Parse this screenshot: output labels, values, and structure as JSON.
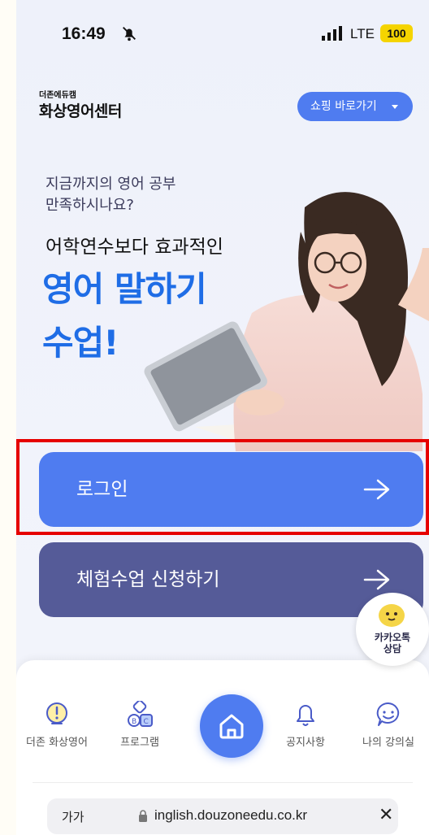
{
  "status": {
    "time": "16:49",
    "network": "LTE",
    "battery": "100"
  },
  "header": {
    "brand_small": "더존에듀캠",
    "brand_main": "화상영어센터",
    "shop_button": "쇼핑 바로가기"
  },
  "hero": {
    "question_line1": "지금까지의 영어 공부",
    "question_line2": "만족하시나요?",
    "subtitle": "어학연수보다 효과적인",
    "headline1": "영어 말하기",
    "headline2": "수업!"
  },
  "buttons": {
    "login": "로그인",
    "trial": "체험수업 신청하기"
  },
  "kakao": {
    "line1": "카카오톡",
    "line2": "상담"
  },
  "nav": {
    "items": [
      {
        "label": "더존 화상영어",
        "icon": "alert-circle-icon"
      },
      {
        "label": "프로그램",
        "icon": "abc-blocks-icon"
      },
      {
        "label": "",
        "icon": "home-icon"
      },
      {
        "label": "공지사항",
        "icon": "bell-icon"
      },
      {
        "label": "나의 강의실",
        "icon": "smile-chat-icon"
      }
    ]
  },
  "browser": {
    "text_size": "가가",
    "url": "inglish.douzoneedu.co.kr"
  },
  "colors": {
    "primary": "#4f7cf0",
    "secondary": "#555b98",
    "headline": "#1f6de6",
    "highlight": "#e60000"
  }
}
